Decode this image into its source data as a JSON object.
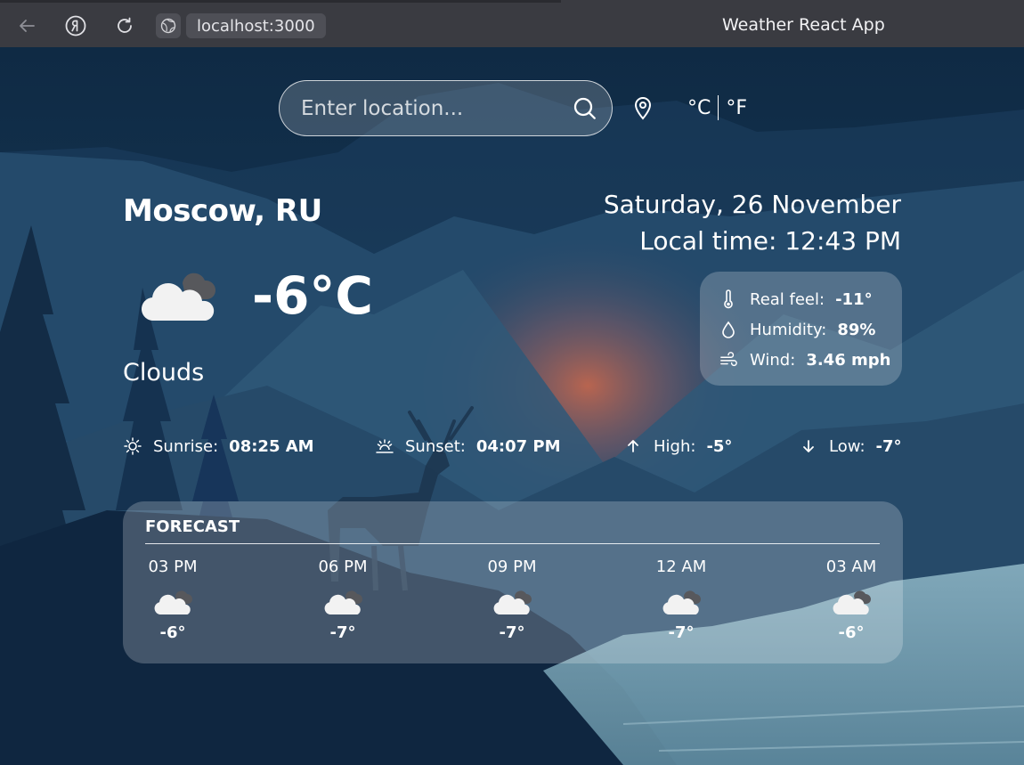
{
  "browser": {
    "address": "localhost:3000",
    "window_title": "Weather React App"
  },
  "search": {
    "placeholder": "Enter location..."
  },
  "units": {
    "celsius": "°C",
    "fahrenheit": "°F"
  },
  "current": {
    "city": "Moscow, RU",
    "date": "Saturday, 26 November",
    "local_time": "Local time: 12:43 PM",
    "temperature": "-6°C",
    "condition": "Clouds",
    "icon": "clouds-icon"
  },
  "details": {
    "real_feel_label": "Real feel:",
    "real_feel_value": "-11°",
    "humidity_label": "Humidity:",
    "humidity_value": "89%",
    "wind_label": "Wind:",
    "wind_value": "3.46 mph"
  },
  "sun": {
    "sunrise_label": "Sunrise:",
    "sunrise_value": "08:25 AM",
    "sunset_label": "Sunset:",
    "sunset_value": "04:07 PM",
    "high_label": "High:",
    "high_value": "-5°",
    "low_label": "Low:",
    "low_value": "-7°"
  },
  "forecast": {
    "heading": "FORECAST",
    "items": [
      {
        "time": "03 PM",
        "temp": "-6°",
        "icon": "clouds-icon"
      },
      {
        "time": "06 PM",
        "temp": "-7°",
        "icon": "clouds-icon"
      },
      {
        "time": "09 PM",
        "temp": "-7°",
        "icon": "clouds-icon"
      },
      {
        "time": "12 AM",
        "temp": "-7°",
        "icon": "clouds-icon"
      },
      {
        "time": "03 AM",
        "temp": "-6°",
        "icon": "clouds-icon"
      }
    ]
  }
}
